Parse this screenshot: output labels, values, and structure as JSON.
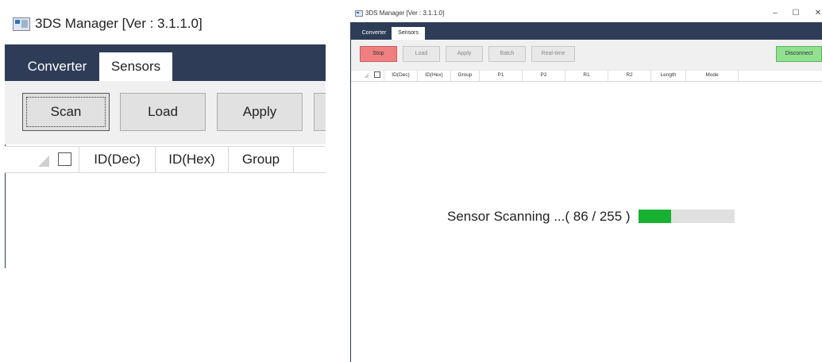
{
  "zoom": {
    "window_title": "3DS Manager [Ver : 3.1.1.0]",
    "tabs": [
      "Converter",
      "Sensors"
    ],
    "buttons": [
      "Scan",
      "Load",
      "Apply"
    ],
    "columns": [
      "ID(Dec)",
      "ID(Hex)",
      "Group"
    ]
  },
  "app": {
    "window_title": "3DS Manager [Ver : 3.1.1.0]",
    "window_controls": {
      "minimize": "–",
      "maximize": "☐",
      "close": "✕"
    },
    "tabs": [
      "Converter",
      "Sensors"
    ],
    "toolbar": {
      "stop": "Stop",
      "load": "Load",
      "apply": "Apply",
      "batch": "Batch",
      "realtime": "Real-time",
      "disconnect": "Disconnect"
    },
    "columns": [
      "ID(Dec)",
      "ID(Hex)",
      "Group",
      "P1",
      "P2",
      "R1",
      "R2",
      "Length",
      "Mode"
    ],
    "scan_status": "Sensor Scanning ...( 86 / 255 )",
    "progress": {
      "current": 86,
      "total": 255
    },
    "colors": {
      "nav": "#2e3c57",
      "stop": "#f08080",
      "disconnect": "#90e090",
      "progress": "#18b030"
    }
  }
}
